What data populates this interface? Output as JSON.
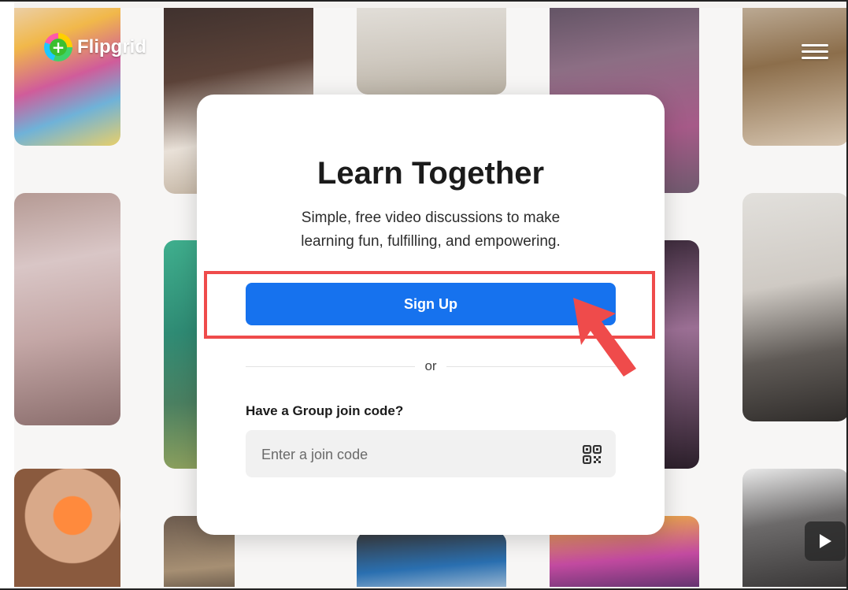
{
  "header": {
    "logo_text": "Flipgrid",
    "menu_icon": "hamburger-menu-icon"
  },
  "card": {
    "title": "Learn Together",
    "subtitle_line1": "Simple, free video discussions to make",
    "subtitle_line2": "learning fun, fulfilling, and empowering.",
    "signup_label": "Sign Up",
    "divider_text": "or",
    "join_label": "Have a Group join code?",
    "join_placeholder": "Enter a join code",
    "qr_icon": "qr-code-icon"
  },
  "colors": {
    "primary_button": "#1672ee",
    "highlight_box": "#ef4b4b",
    "arrow": "#ef4b4b"
  },
  "media": {
    "play_icon": "play-icon"
  }
}
